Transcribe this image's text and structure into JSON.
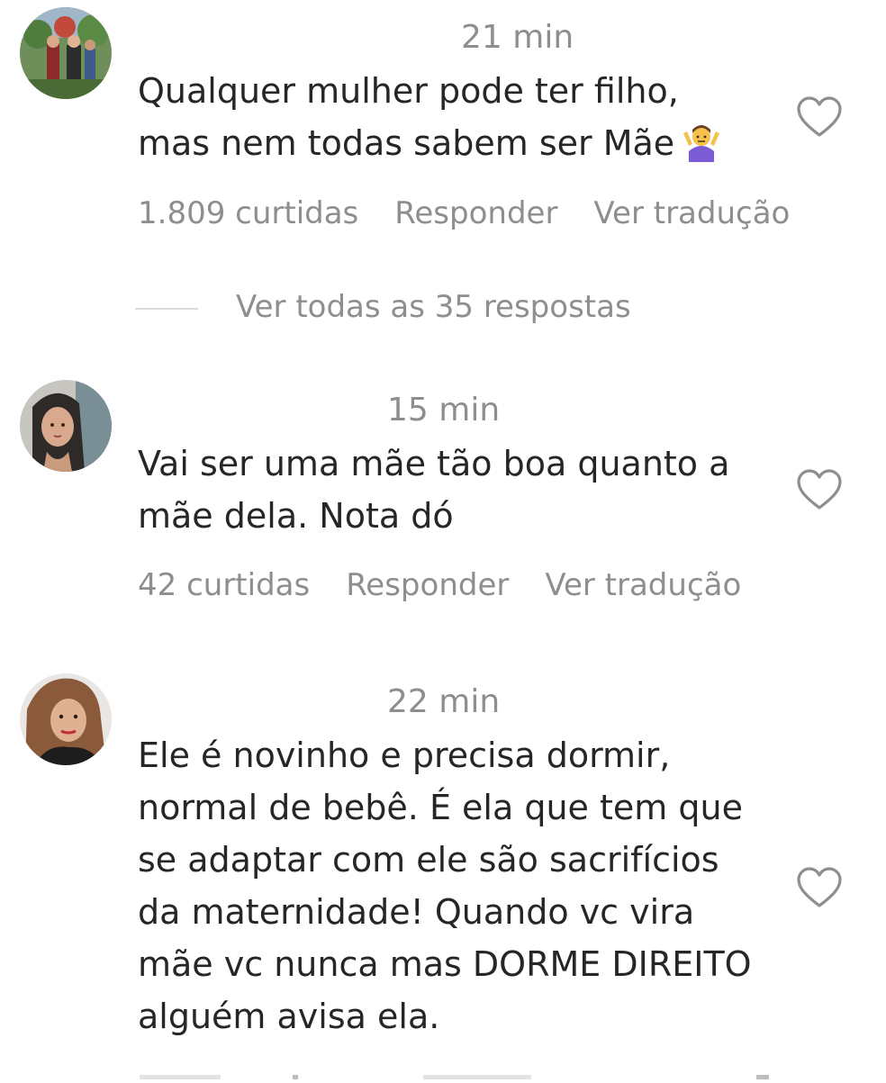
{
  "comments": [
    {
      "time": "21 min",
      "text": "Qualquer mulher pode ter filho,\nmas nem todas sabem ser Mãe",
      "emoji": "person-shrugging",
      "likes": "1.809 curtidas",
      "reply": "Responder",
      "translate": "Ver tradução"
    },
    {
      "time": "15 min",
      "text": "Vai ser uma mãe tão boa quanto a\nmãe dela. Nota dó",
      "likes": "42 curtidas",
      "reply": "Responder",
      "translate": "Ver tradução"
    },
    {
      "time": "22 min",
      "text": "Ele é novinho e precisa dormir,\nnormal de bebê. É ela que tem que\nse adaptar com ele são sacrifícios\nda maternidade! Quando vc vira\nmãe vc nunca mas DORME DIREITO\nalguém avisa ela."
    }
  ],
  "replies_link": "Ver todas as 35 respostas",
  "colors": {
    "text": "#262626",
    "muted": "#8e8e8e",
    "divider": "#dbdbdb"
  }
}
